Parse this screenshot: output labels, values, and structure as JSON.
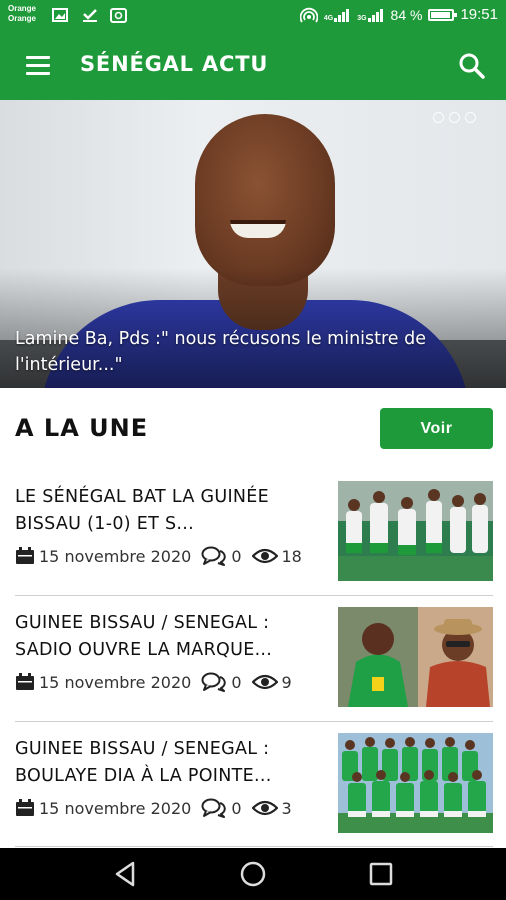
{
  "status_bar": {
    "carrier_line1": "Orange",
    "carrier_line2": "Orange",
    "net1": "4G",
    "net2": "3G",
    "battery_text": "84 %",
    "battery_level": 0.84,
    "time": "19:51"
  },
  "app_bar": {
    "title": "SÉNÉGAL ACTU",
    "menu_icon": "hamburger-menu-icon",
    "search_icon": "search-icon"
  },
  "hero": {
    "caption": "Lamine Ba, Pds :\" nous récusons le ministre de l'intérieur...\"",
    "slides_count": 3
  },
  "section": {
    "title": "A LA UNE",
    "voir_label": "Voir"
  },
  "articles": [
    {
      "title": "LE SÉNÉGAL BAT LA GUINÉE BISSAU (1-0) ET S...",
      "date": "15 novembre 2020",
      "comments": "0",
      "views": "18"
    },
    {
      "title": "GUINEE BISSAU / SENEGAL : SADIO OUVRE LA MARQUE...",
      "date": "15 novembre 2020",
      "comments": "0",
      "views": "9"
    },
    {
      "title": "GUINEE BISSAU / SENEGAL : BOULAYE DIA À LA POINTE...",
      "date": "15 novembre 2020",
      "comments": "0",
      "views": "3"
    }
  ],
  "colors": {
    "primary_green": "#1f9a3a",
    "text_dark": "#111111",
    "divider": "#cfcfcf"
  },
  "icons": {
    "calendar": "calendar-icon",
    "comments": "comments-icon",
    "views": "eye-icon",
    "nav_back": "back-triangle-icon",
    "nav_home": "home-circle-icon",
    "nav_recents": "recents-square-icon"
  }
}
